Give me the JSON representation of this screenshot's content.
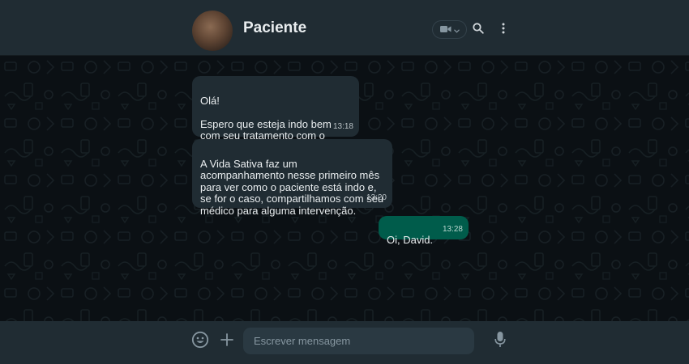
{
  "header": {
    "contact_name": "Paciente",
    "avatar_icon": "avatar-photo",
    "video_icon": "video-camera-icon",
    "dropdown_icon": "chevron-down-icon",
    "search_icon": "search-icon",
    "menu_icon": "more-vertical-icon"
  },
  "messages": [
    {
      "direction": "incoming",
      "text": "Olá!\n\nEspero que esteja indo bem com seu tratamento com o CBD.",
      "time": "13:18"
    },
    {
      "direction": "incoming",
      "text": "A Vida Sativa faz um acompanhamento nesse primeiro mês para ver como o paciente está indo e, se for o caso, compartilhamos com seu médico para alguma intervenção.",
      "time": "13:20"
    },
    {
      "direction": "outgoing",
      "text": "Oi, David.",
      "time": "13:28"
    }
  ],
  "footer": {
    "emoji_icon": "emoji-icon",
    "attach_icon": "plus-icon",
    "input_placeholder": "Escrever mensagem",
    "input_value": "",
    "mic_icon": "microphone-icon"
  },
  "colors": {
    "header_bg": "#202c33",
    "chat_bg": "#0b1014",
    "incoming_bubble": "#202c33",
    "outgoing_bubble": "#005c4b",
    "input_bg": "#2a3942"
  }
}
